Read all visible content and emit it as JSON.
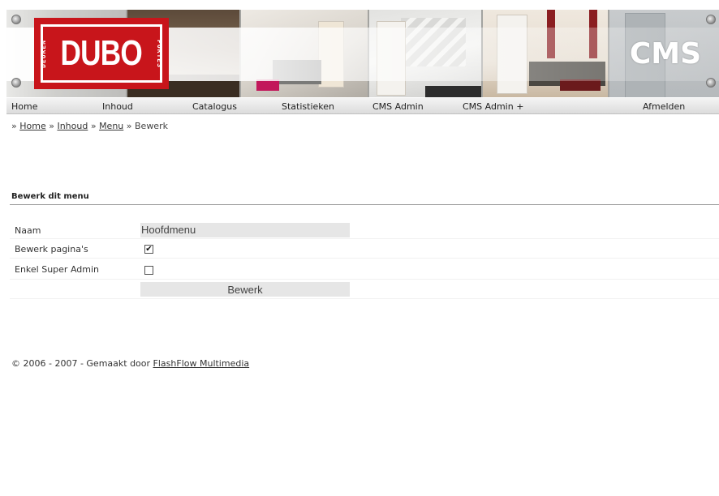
{
  "banner": {
    "logo": {
      "word": "DUBO",
      "left_text": "DEUREN",
      "right_text": "PORTES"
    },
    "cms_label": "CMS"
  },
  "nav": {
    "items": [
      "Home",
      "Inhoud",
      "Catalogus",
      "Statistieken",
      "CMS Admin",
      "CMS Admin +",
      "Afmelden"
    ]
  },
  "breadcrumb": {
    "separator": "»",
    "links": [
      "Home",
      "Inhoud",
      "Menu"
    ],
    "current": "Bewerk"
  },
  "form": {
    "title": "Bewerk dit menu",
    "fields": {
      "naam": {
        "label": "Naam",
        "value": "Hoofdmenu"
      },
      "bewerk_paginas": {
        "label": "Bewerk pagina's",
        "checked": true,
        "mark": "✔"
      },
      "enkel_super_admin": {
        "label": "Enkel Super Admin",
        "checked": false,
        "mark": ""
      }
    },
    "submit_label": "Bewerk"
  },
  "footer": {
    "text": "© 2006 - 2007 - Gemaakt door",
    "link": "FlashFlow Multimedia"
  },
  "colors": {
    "logo_red": "#c8151b",
    "nav_bg": "#dcdcdc",
    "field_bg": "#e6e6e6"
  }
}
